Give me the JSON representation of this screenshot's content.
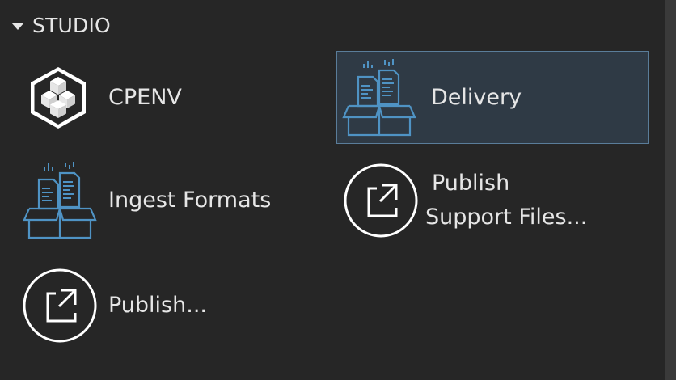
{
  "section": {
    "title": "STUDIO",
    "caret_icon": "caret-down-icon"
  },
  "tiles": [
    {
      "label": "CPENV",
      "icon": "cubes-hexagon-icon",
      "selected": false
    },
    {
      "label": "Delivery",
      "icon": "box-documents-icon",
      "selected": true
    },
    {
      "label": "Ingest Formats",
      "icon": "box-documents-icon",
      "selected": false
    },
    {
      "label_line1": "Publish",
      "label_line2": "Support Files...",
      "icon": "external-link-circle-icon",
      "selected": false
    },
    {
      "label": "Publish...",
      "icon": "external-link-circle-icon",
      "selected": false
    }
  ],
  "colors": {
    "background": "#262626",
    "text": "#e6e6e6",
    "selected_bg": "#2f3a45",
    "selected_border": "#5a7d9a",
    "icon_blue": "#4f93c4"
  }
}
